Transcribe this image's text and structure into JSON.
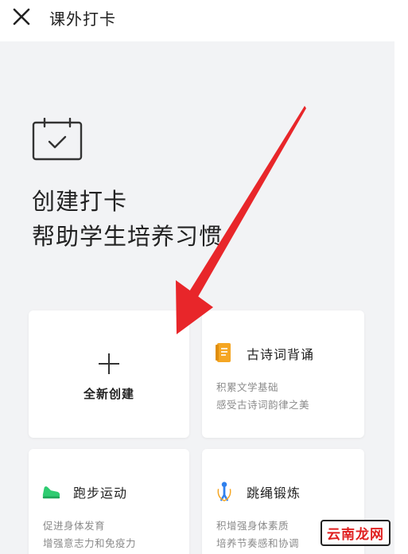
{
  "header": {
    "title": "课外打卡",
    "close_icon": "close-icon"
  },
  "hero": {
    "icon": "calendar-check-icon",
    "line1": "创建打卡",
    "line2": "帮助学生培养习惯"
  },
  "cards": {
    "new": {
      "label": "全新创建",
      "icon": "plus-icon"
    },
    "poem": {
      "title": "古诗词背诵",
      "desc1": "积累文学基础",
      "desc2": "感受古诗词韵律之美",
      "icon": "book-icon",
      "color": "#f5a623"
    },
    "run": {
      "title": "跑步运动",
      "desc1": "促进身体发育",
      "desc2": "增强意志力和免疫力",
      "icon": "sneaker-icon",
      "color": "#2ecc71"
    },
    "rope": {
      "title": "跳绳锻炼",
      "desc1": "积增强身体素质",
      "desc2": "培养节奏感和协调",
      "icon": "jump-rope-icon",
      "color": "#2f80ed"
    }
  },
  "watermark": "云南龙网",
  "colors": {
    "arrow": "#e8262a",
    "background": "#f2f3f5"
  }
}
